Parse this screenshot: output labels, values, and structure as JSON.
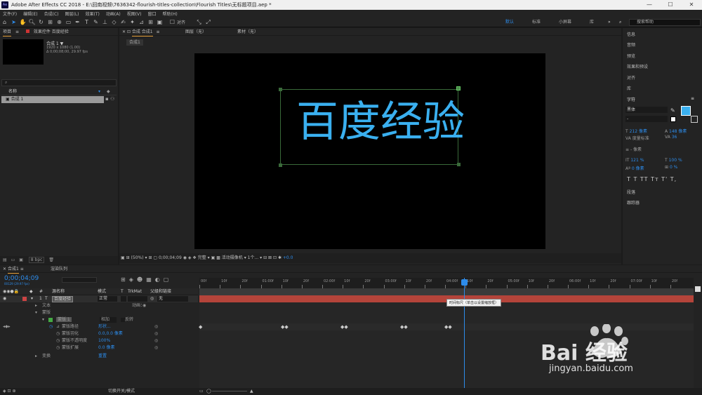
{
  "window": {
    "title": "Adobe After Effects CC 2018 - E:\\回南视频\\7636342-flourish-titles-collection\\Flourish Titles\\无标题项目.aep *",
    "controls": [
      "—",
      "☐",
      "✕"
    ]
  },
  "menu": [
    "文件(F)",
    "编辑(E)",
    "合成(C)",
    "图层(L)",
    "效果(T)",
    "动画(A)",
    "视图(V)",
    "窗口",
    "帮助(H)"
  ],
  "toolbar": {
    "snap_label": "对齐",
    "workspaces": [
      "默认",
      "标准",
      "小屏幕",
      "库"
    ],
    "more": "»",
    "search_placeholder": "搜索帮助"
  },
  "project": {
    "tab_project": "项目",
    "tab_effects": "效果控件 百度经验",
    "comp_name": "合成 1 ▼",
    "comp_info_1": "1920 x 1080 (1.00)",
    "comp_info_2": "Δ 0;00;08;00, 29.97 fps",
    "search_icon": "⌕",
    "col_name": "名称",
    "item": "合成 1",
    "bpc": "8 bpc"
  },
  "viewer": {
    "tab_comp": "合成 合成1",
    "tab_layer": "图层（无）",
    "tab_footage": "素材（无）",
    "breadcrumb": "合成1",
    "text": "百度经验",
    "text_color": "#3ab0f0",
    "zoom": "(50%)",
    "timecode": "0;00;04;09",
    "quality": "完整",
    "camera": "活动摄像机",
    "views": "1个...",
    "exposure": "+0.0"
  },
  "right": {
    "items": [
      "信息",
      "音频",
      "预览",
      "效果和预设",
      "对齐",
      "库"
    ],
    "char_title": "字符",
    "font": "黑体",
    "font_style": "-",
    "size": "212 像素",
    "leading": "148 像素",
    "kerning": "度量标准",
    "tracking": "36",
    "stroke": "- 像素",
    "vscale": "121 %",
    "hscale": "100 %",
    "baseline": "0 像素",
    "tsume": "0 %",
    "styles": [
      "T",
      "T",
      "TT",
      "Tт",
      "T'",
      "T,"
    ],
    "para": "段落",
    "tracker": "跟踪器",
    "fill_color": "#3ab0f0"
  },
  "timeline": {
    "tab": "合成1",
    "tab2": "渲染队列",
    "timecode": "0;00;04;09",
    "fps": "00129 (29.97 fps)",
    "col_num": "#",
    "col_name": "源名称",
    "col_mode": "模式",
    "col_t": "T",
    "col_trkmat": "TrkMat",
    "col_parent": "父级和链接",
    "layer_num": "1",
    "layer_name": "百度经验",
    "layer_mode": "正常",
    "layer_parent": "无",
    "prop_text": "文本",
    "anim_label": "动画：",
    "prop_mask": "蒙版",
    "mask_name": "蒙版 1",
    "mask_mode": "相加",
    "mask_invert": "反转",
    "mask_path": "蒙版路径",
    "mask_path_val": "形状...",
    "mask_feather": "蒙版羽化",
    "mask_feather_val": "0.0,0.0 像素",
    "mask_opacity": "蒙版不透明度",
    "mask_opacity_val": "100%",
    "mask_expand": "蒙版扩展",
    "mask_expand_val": "0.0 像素",
    "prop_transform": "变换",
    "reset": "重置",
    "ruler": [
      "00f",
      "10f",
      "20f",
      "01:00f",
      "10f",
      "20f",
      "02:00f",
      "10f",
      "20f",
      "03:00f",
      "10f",
      "20f",
      "04:00f",
      "10f",
      "20f",
      "05:00f",
      "10f",
      "20f",
      "06:00f",
      "10f",
      "20f",
      "07:00f",
      "10f",
      "20f"
    ],
    "tooltip": "时间标尺（单击以设置缩放框）",
    "toggle": "切换开关/模式"
  },
  "watermark": {
    "brand": "Bai 经验",
    "url": "jingyan.baidu.com"
  }
}
